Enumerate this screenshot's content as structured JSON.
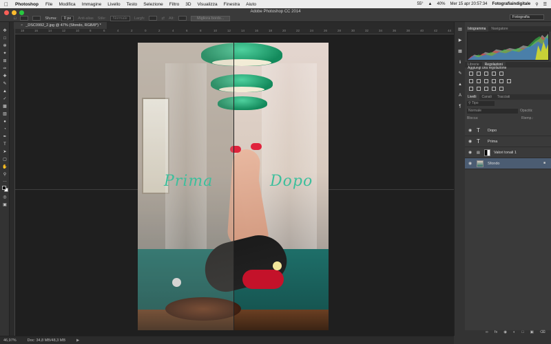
{
  "menubar": {
    "app_name": "Photoshop",
    "items": [
      "File",
      "Modifica",
      "Immagine",
      "Livello",
      "Testo",
      "Selezione",
      "Filtro",
      "3D",
      "Visualizza",
      "Finestra",
      "Aiuto"
    ],
    "temperature": "55°",
    "battery": "40%",
    "datetime": "Mer 15 apr  20:57:34",
    "user": "Fotografiaindigitale"
  },
  "window": {
    "title": "Adobe Photoshop CC 2014"
  },
  "options_bar": {
    "feather_label": "Sfuma:",
    "feather_value": "0 px",
    "antialias_label": "Anti-alias",
    "style_label": "Stile:",
    "style_value": "Normale",
    "width_label": "Largh:",
    "height_label": "Alt:",
    "refine_button": "Migliora bordo...",
    "workspace": "Fotografia"
  },
  "document": {
    "tab_title": "_DSC0992_2.jpg @ 47% (Sfondo, RGB/8*) *"
  },
  "canvas": {
    "text_before": "Prima",
    "text_after": "Dopo"
  },
  "ruler": {
    "top_ticks": [
      "18",
      "16",
      "14",
      "12",
      "10",
      "8",
      "6",
      "4",
      "2",
      "0",
      "2",
      "4",
      "6",
      "8",
      "10",
      "12",
      "14",
      "16",
      "18",
      "20",
      "22",
      "24",
      "26",
      "28",
      "30",
      "32",
      "34",
      "36",
      "38",
      "40",
      "42",
      "44"
    ]
  },
  "panels": {
    "top_tabs": [
      "Istogramma",
      "Navigatore"
    ],
    "mid_tabs": [
      "Librerie",
      "Regolazioni"
    ],
    "adjustments_title": "Aggiungi una regolazione",
    "layers_tabs": [
      "Livelli",
      "Canali",
      "Tracciati"
    ],
    "filter_label": "Tipo",
    "blend_mode": "Normale",
    "opacity_label": "Opacità:",
    "lock_label": "Blocca:",
    "fill_label": "Riemp.:",
    "layers": [
      {
        "name": "Dopo",
        "kind": "text"
      },
      {
        "name": "Prima",
        "kind": "text"
      },
      {
        "name": "Valori tonali 1",
        "kind": "adjustment"
      },
      {
        "name": "Sfondo",
        "kind": "image"
      }
    ]
  },
  "status": {
    "zoom": "46,97%",
    "doc_size": "Doc: 34,8 MB/48,3 MB"
  },
  "colors": {
    "script_text": "#3dbf9c",
    "selected_layer": "#4b5c72",
    "lamp_green": "#138a5c",
    "shoe_red": "#e0223c"
  }
}
